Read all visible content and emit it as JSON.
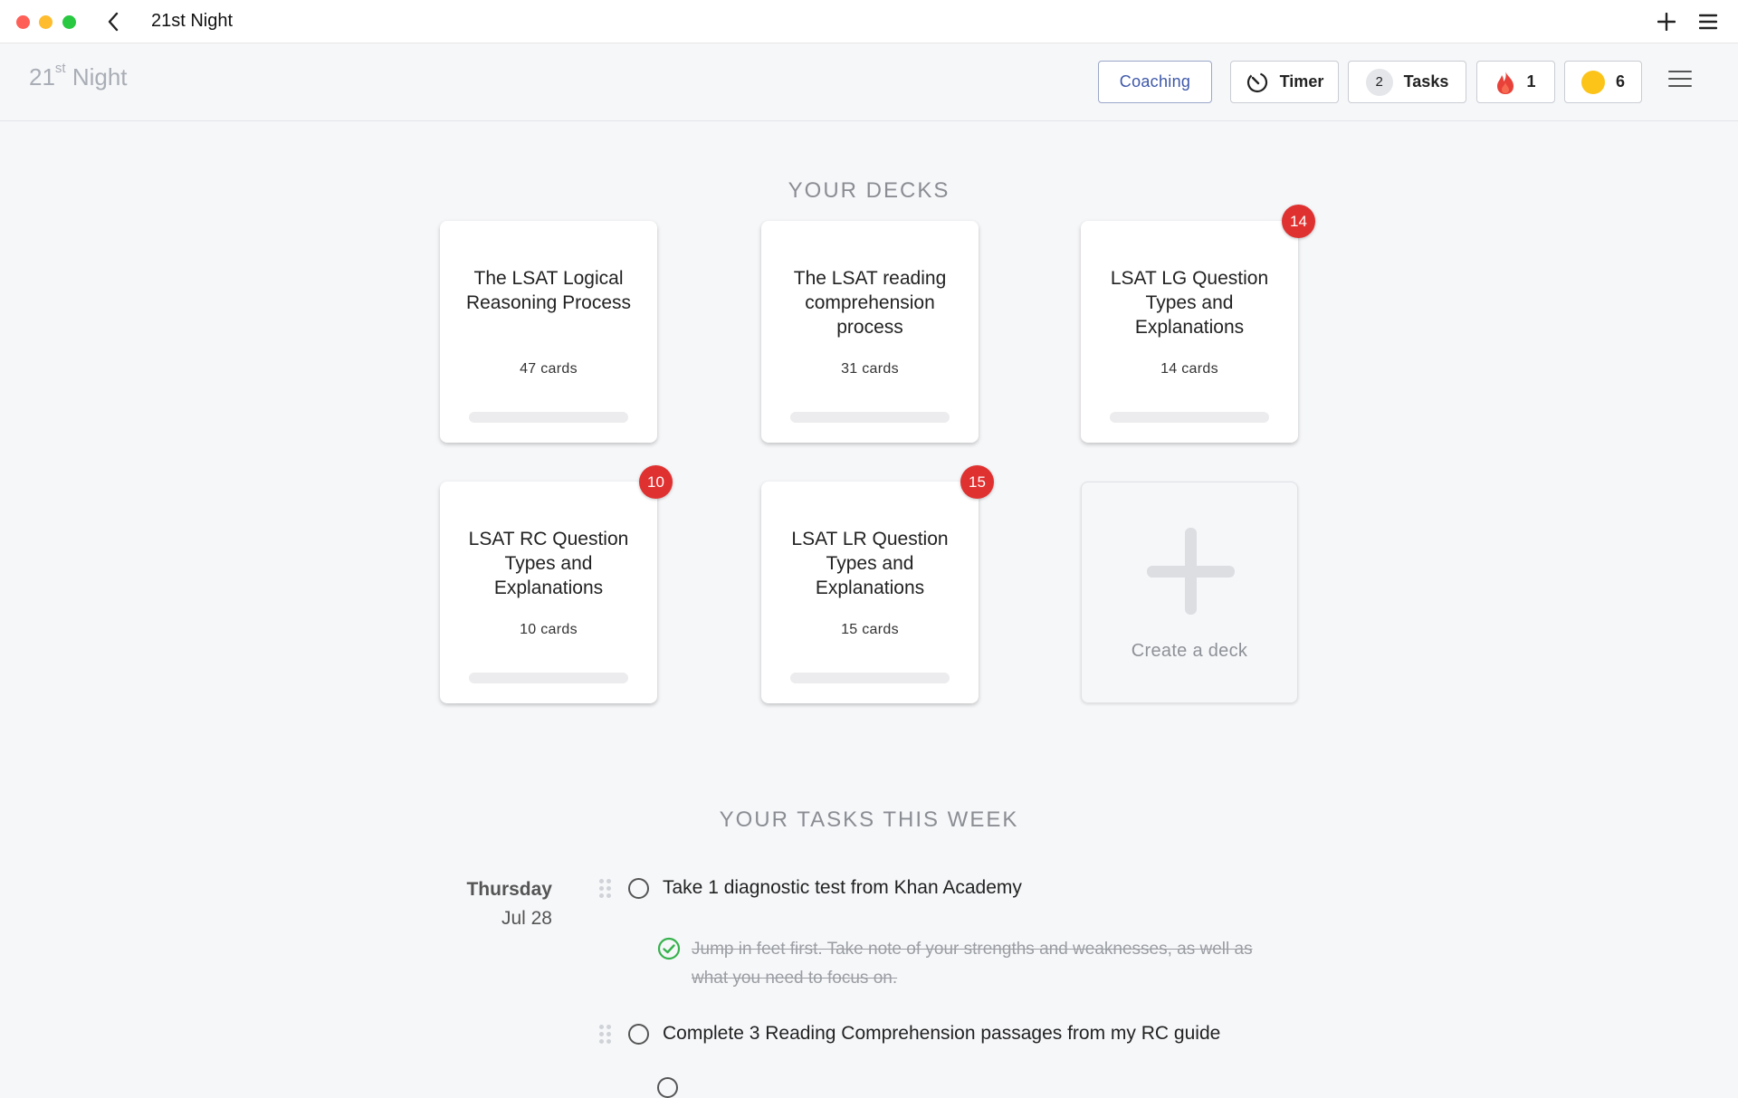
{
  "window": {
    "title": "21st Night"
  },
  "brand": {
    "base": "21",
    "sup": "st",
    "rest": " Night"
  },
  "header": {
    "coaching_label": "Coaching",
    "timer_label": "Timer",
    "tasks_count": "2",
    "tasks_label": "Tasks",
    "streak_count": "1",
    "coins_count": "6"
  },
  "decks_title": "YOUR DECKS",
  "decks": [
    {
      "name": "The LSAT Logical Reasoning Process",
      "count": "47 cards",
      "badge": ""
    },
    {
      "name": "The LSAT reading comprehension process",
      "count": "31 cards",
      "badge": ""
    },
    {
      "name": "LSAT LG Question Types and Explanations",
      "count": "14 cards",
      "badge": "14"
    },
    {
      "name": "LSAT RC Question Types and Explanations",
      "count": "10 cards",
      "badge": "10"
    },
    {
      "name": "LSAT LR Question Types and Explanations",
      "count": "15 cards",
      "badge": "15"
    }
  ],
  "create_deck_label": "Create a deck",
  "tasks_title": "YOUR TASKS THIS WEEK",
  "day": {
    "name": "Thursday",
    "date": "Jul 28"
  },
  "tasks": [
    {
      "text": "Take 1 diagnostic test from Khan Academy",
      "done": false
    },
    {
      "text": "Complete 3 Reading Comprehension passages from my RC guide",
      "done": false
    }
  ],
  "subtask": {
    "text": "Jump in feet first. Take note of your strengths and weaknesses, as well as what you need to focus on.",
    "done": true
  },
  "colors": {
    "accent": "#3d57a8",
    "badge": "#e03131",
    "coin": "#fcc419",
    "done": "#37b24d"
  }
}
